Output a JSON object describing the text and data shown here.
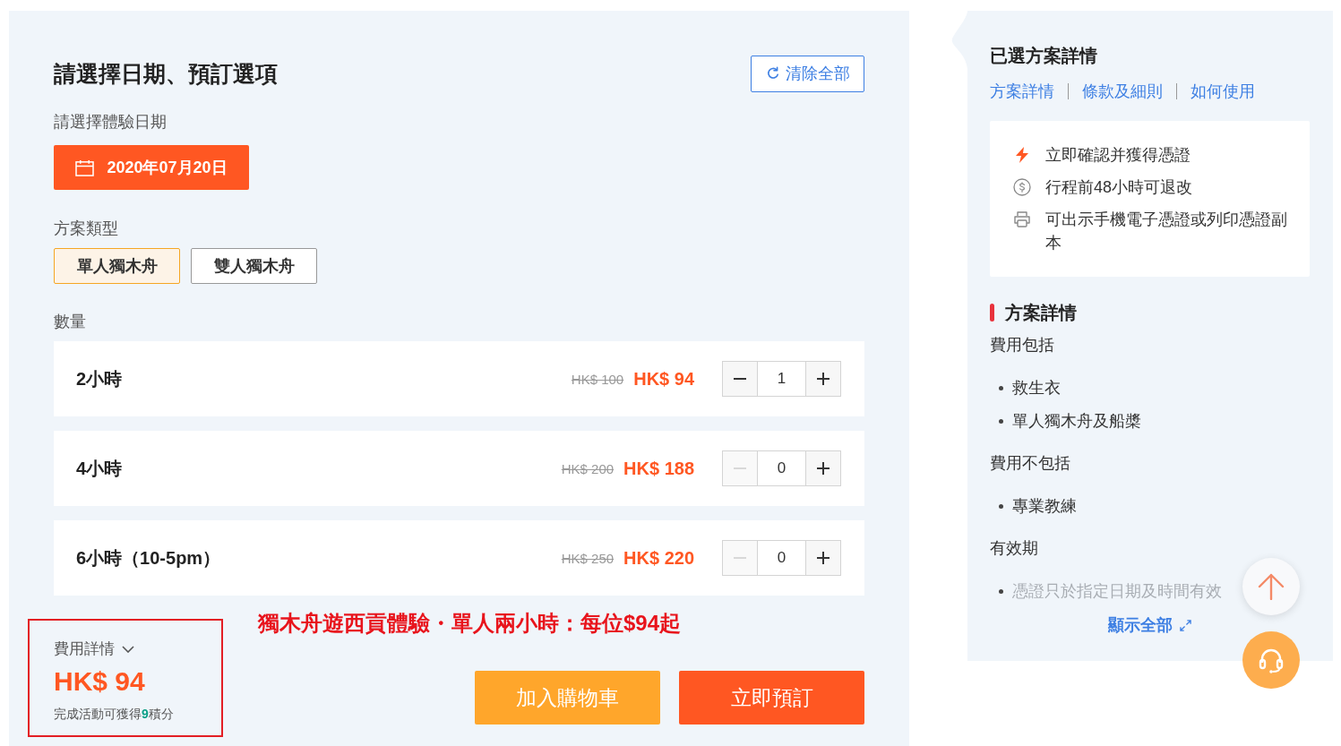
{
  "booking": {
    "title": "請選擇日期、預訂選項",
    "clear_button": "清除全部",
    "date_label": "請選擇體驗日期",
    "date": "2020年07月20日",
    "package_label": "方案類型",
    "packages": [
      {
        "label": "單人獨木舟",
        "selected": true
      },
      {
        "label": "雙人獨木舟",
        "selected": false
      }
    ],
    "quantity_label": "數量",
    "options": [
      {
        "name": "2小時",
        "original_price": "HK$ 100",
        "price": "HK$ 94",
        "quantity": "1",
        "minus_disabled": false
      },
      {
        "name": "4小時",
        "original_price": "HK$ 200",
        "price": "HK$ 188",
        "quantity": "0",
        "minus_disabled": true
      },
      {
        "name": "6小時（10-5pm）",
        "original_price": "HK$ 250",
        "price": "HK$ 220",
        "quantity": "0",
        "minus_disabled": true
      }
    ]
  },
  "summary": {
    "highlighted": true,
    "toggle": "費用詳情",
    "total": "HK$ 94",
    "points_note": "完成活動可獲得**9**積分"
  },
  "caption": "獨木舟遊西貢體驗・單人兩小時：每位$94起",
  "actions": [
    {
      "kind": "cart",
      "label": "加入購物車"
    },
    {
      "kind": "book",
      "label": "立即預訂"
    }
  ],
  "selected_package": {
    "title": "已選方案詳情",
    "links": [
      "方案詳情",
      "條款及細則",
      "如何使用"
    ],
    "features": [
      {
        "kind": "instant",
        "text": "立即確認并獲得憑證"
      },
      {
        "kind": "refund",
        "text": "行程前48小時可退改"
      },
      {
        "kind": "print",
        "text": "可出示手機電子憑證或列印憑證副本"
      }
    ],
    "section_title": "方案詳情",
    "collapsed": true,
    "details": [
      {
        "heading": "費用包括",
        "items": [
          "救生衣",
          "單人獨木舟及船槳"
        ]
      },
      {
        "heading": "費用不包括",
        "items": [
          "專業教練"
        ]
      },
      {
        "heading": "有效期",
        "items": [
          "憑證只於指定日期及時間有效"
        ]
      }
    ],
    "show_all": "顯示全部"
  }
}
